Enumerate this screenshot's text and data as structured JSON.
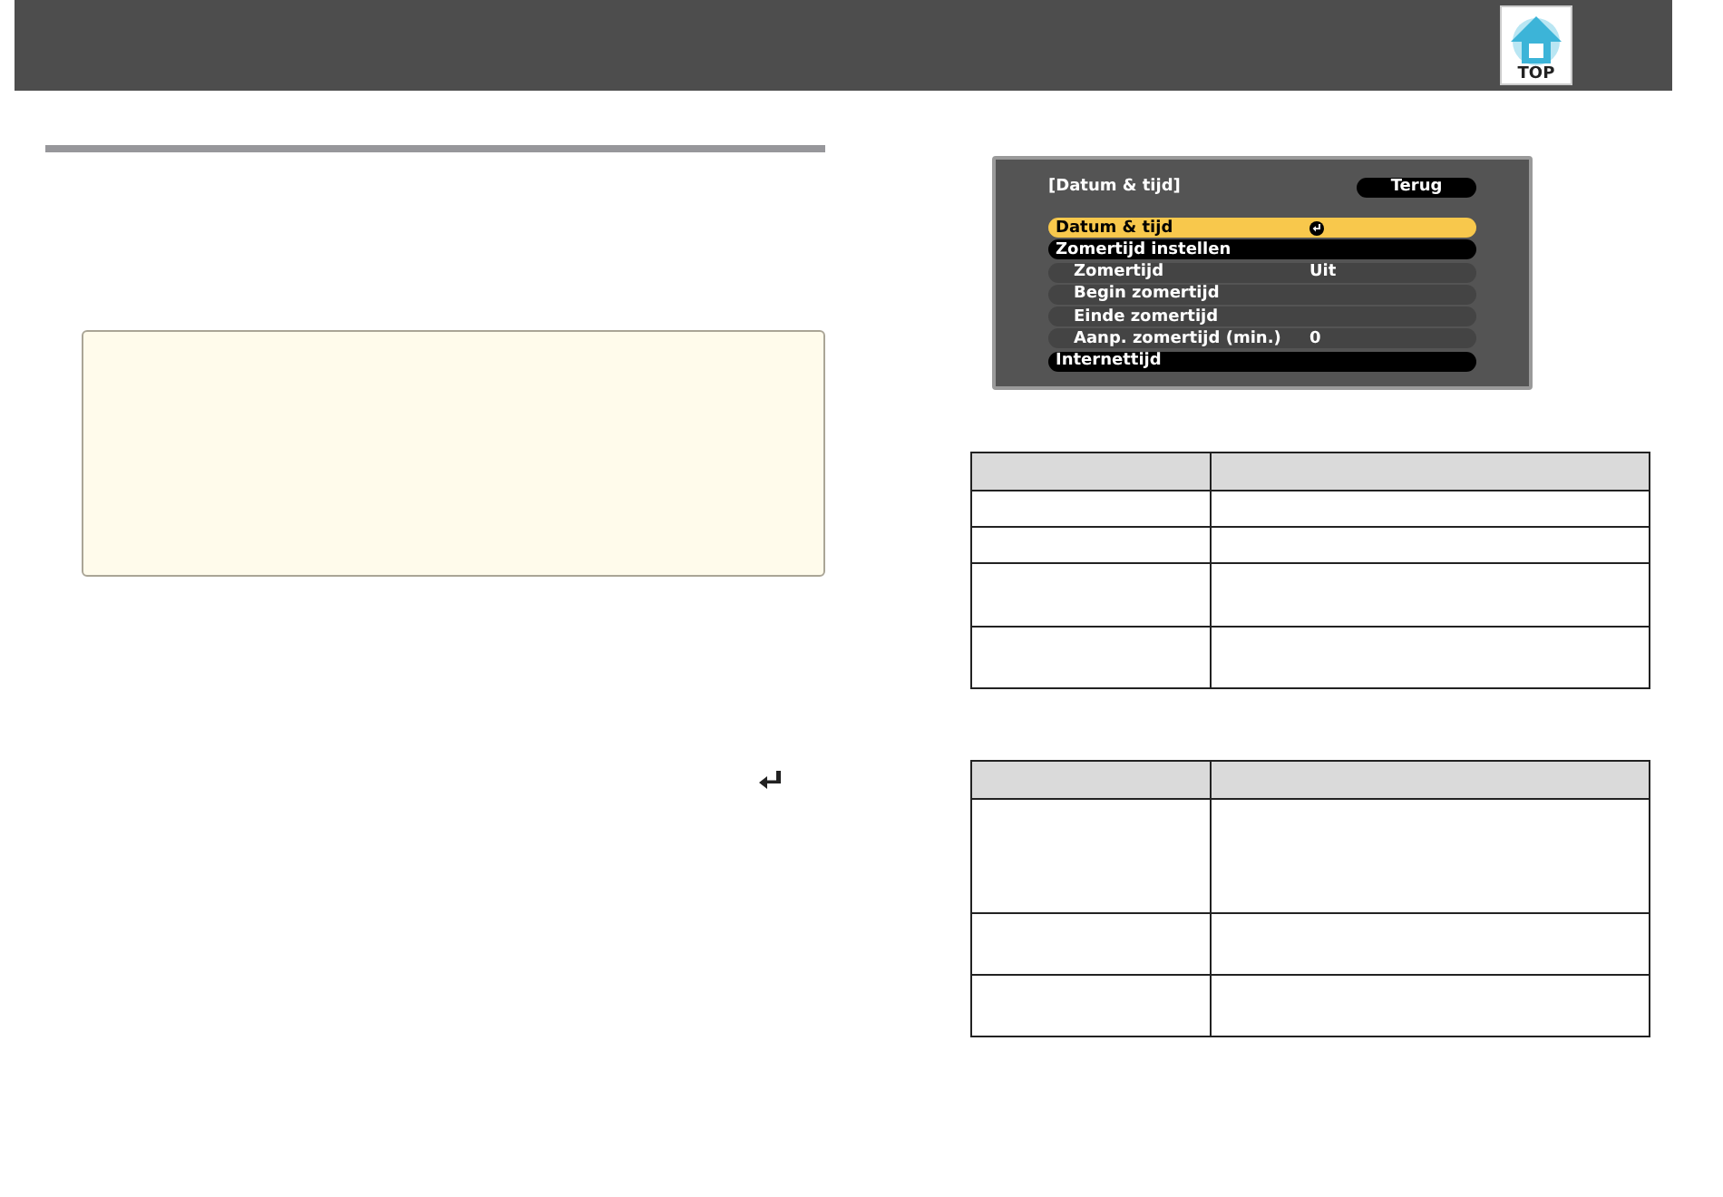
{
  "header": {
    "top_button": "TOP"
  },
  "osd_menu": {
    "title": "[Datum & tijd]",
    "back_button": "Terug",
    "items": [
      {
        "label": "Datum & tijd",
        "kind": "action",
        "selected": true
      },
      {
        "label": "Zomertijd instellen",
        "kind": "group",
        "selected": false
      },
      {
        "label": "Zomertijd",
        "value": "Uit",
        "kind": "setting",
        "selected": false
      },
      {
        "label": "Begin zomertijd",
        "kind": "setting",
        "selected": false
      },
      {
        "label": "Einde zomertijd",
        "kind": "setting",
        "selected": false
      },
      {
        "label": "Aanp. zomertijd (min.)",
        "value": "0",
        "kind": "setting",
        "selected": false
      },
      {
        "label": "Internettijd",
        "kind": "group",
        "selected": false
      }
    ]
  }
}
